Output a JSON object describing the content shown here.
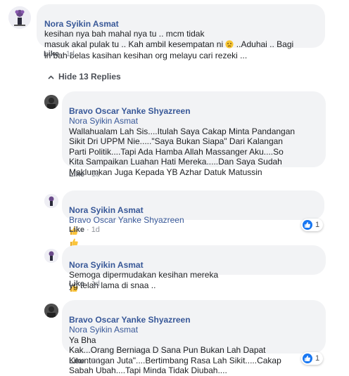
{
  "comment": {
    "author": "Nora Syikin Asmat",
    "text_part1": "kesihan nya bah mahal nya tu .. mcm tidak\nmasuk akal pulak tu .. Kah ambil kesempatan ni ",
    "text_part2": " ..Aduhai .. Bagi\nlh bah belas kasihan kesihan org melayu cari rezeki ...",
    "like_label": "Like",
    "time": "1d"
  },
  "replies_toggle": {
    "label": "Hide 13 Replies"
  },
  "replies": [
    {
      "author": "Bravo Oscar Yanke Shyazreen",
      "mention": "Nora Syikin Asmat",
      "text": "Wallahualam Lah Sis....Itulah Saya Cakap Minta Pandangan\nSikit Dri UPPM Nie.....\"Saya Bukan Siapa\" Dari Kalangan\nParti Politik....Tapi Ada Hamba Allah Massanger Aku....So\nKita Sampaikan Luahan Hati Mereka.....Dan Saya Sudah\nMaklumkan Juga Kepada YB Azhar Datuk Matussin",
      "like_label": "Like",
      "time": "1d"
    },
    {
      "author": "Nora Syikin Asmat",
      "mention": "Bravo Oscar Yanke Shyazreen",
      "text": "",
      "like_label": "Like",
      "time": "1d",
      "reaction_count": "1"
    },
    {
      "author": "Nora Syikin Asmat",
      "text": "Semoga dipermudakan kesihan mereka\nyg telah lama di snaa ..",
      "like_label": "Like",
      "time": "1d"
    },
    {
      "author": "Bravo Oscar Yanke Shyazreen",
      "mention": "Nora Syikin Asmat",
      "text": "Ya Bha\nKak...Orang Berniaga D Sana Pun Bukan Lah Dapat\nKeuntungan Juta\"....Bertimbang Rasa Lah Sikit.....Cakap\nSabah Ubah....Tapi Minda Tidak Diubah....",
      "like_label": "Like",
      "time": "1d",
      "reaction_count": "1"
    }
  ],
  "icons": {
    "thumbs_up_emoji": "thumbs-up-emoji",
    "sad_emoji": "disappointed-face-emoji",
    "like_reaction": "like-reaction-icon"
  },
  "colors": {
    "author_link": "#385898",
    "bubble_bg": "#f2f3f5",
    "like_blue": "#1877f2"
  }
}
